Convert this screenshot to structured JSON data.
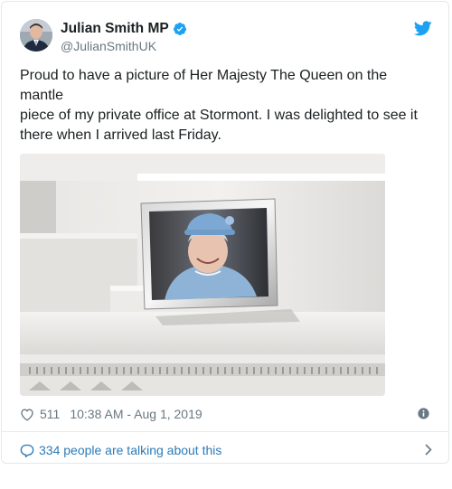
{
  "tweet": {
    "author_name": "Julian Smith MP",
    "author_handle": "@JulianSmithUK",
    "text_lines": [
      "Proud to have a picture of Her Majesty The Queen on the",
      "mantle",
      "piece of my private office at Stormont. I was delighted to see it",
      "there when I arrived last Friday."
    ],
    "like_count": "511",
    "timestamp": "10:38 AM - Aug 1, 2019",
    "conversation_label": "334 people are talking about this"
  },
  "icons": {
    "verified": "verified-badge-icon",
    "brand": "twitter-bird-icon",
    "like": "heart-icon",
    "info": "info-icon",
    "conversation": "speech-bubble-icon",
    "chevron": "chevron-right-icon"
  },
  "colors": {
    "accent": "#1da1f2",
    "link": "#2b7bb9",
    "muted": "#697882",
    "text": "#1c2022",
    "border": "#e1e8ed"
  }
}
